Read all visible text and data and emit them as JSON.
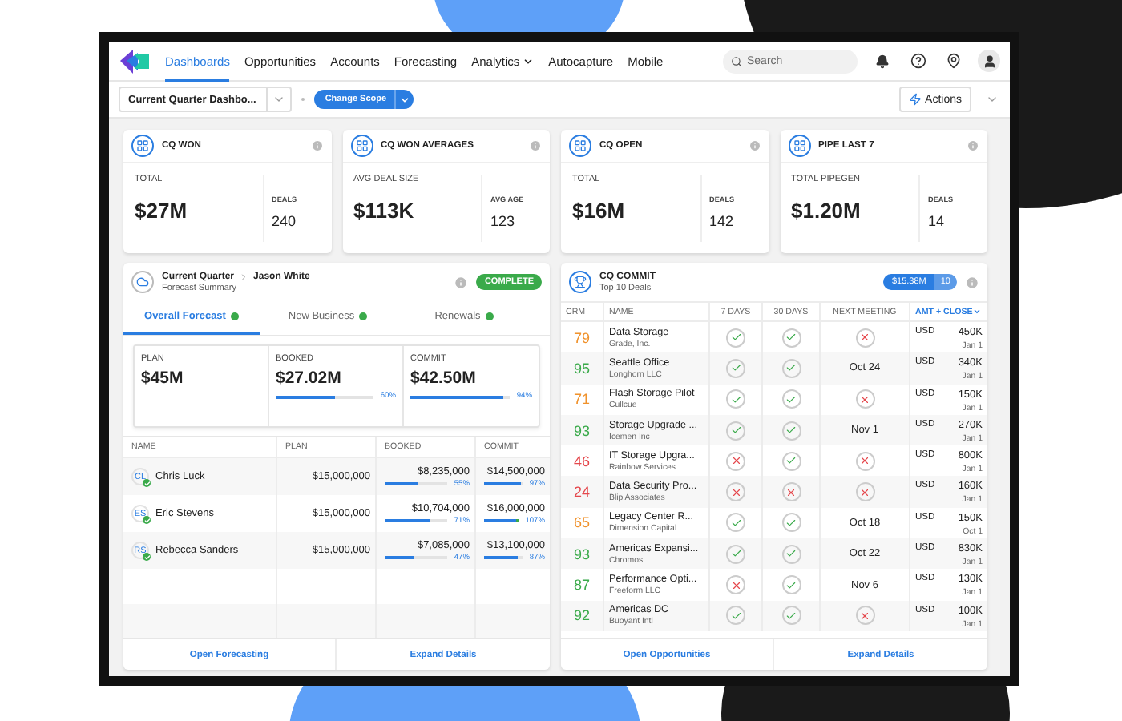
{
  "nav": {
    "items": [
      {
        "label": "Dashboards",
        "selected": true,
        "dropdown": false
      },
      {
        "label": "Opportunities",
        "selected": false,
        "dropdown": false
      },
      {
        "label": "Accounts",
        "selected": false,
        "dropdown": false
      },
      {
        "label": "Forecasting",
        "selected": false,
        "dropdown": false
      },
      {
        "label": "Analytics",
        "selected": false,
        "dropdown": true
      },
      {
        "label": "Autocapture",
        "selected": false,
        "dropdown": false
      },
      {
        "label": "Mobile",
        "selected": false,
        "dropdown": false
      }
    ],
    "search": {
      "placeholder": "Search"
    }
  },
  "toolbar": {
    "dashboard_select": "Current Quarter Dashbo...",
    "scope_button": "Change Scope",
    "actions_button": "Actions"
  },
  "cards": [
    {
      "title": "CQ WON",
      "main_label": "TOTAL",
      "main_value": "$27M",
      "side_label": "DEALS",
      "side_value": "240"
    },
    {
      "title": "CQ WON AVERAGES",
      "main_label": "AVG DEAL SIZE",
      "main_value": "$113K",
      "side_label": "AVG AGE",
      "side_value": "123"
    },
    {
      "title": "CQ OPEN",
      "main_label": "TOTAL",
      "main_value": "$16M",
      "side_label": "DEALS",
      "side_value": "142"
    },
    {
      "title": "PIPE LAST 7",
      "main_label": "TOTAL PIPEGEN",
      "main_value": "$1.20M",
      "side_label": "DEALS",
      "side_value": "14"
    }
  ],
  "forecast": {
    "title": "Current Quarter",
    "owner": "Jason White",
    "subtitle": "Forecast Summary",
    "status": "COMPLETE",
    "tabs": [
      {
        "label": "Overall Forecast",
        "selected": true
      },
      {
        "label": "New Business",
        "selected": false
      },
      {
        "label": "Renewals",
        "selected": false
      }
    ],
    "summary": [
      {
        "label": "PLAN",
        "value": "$45M"
      },
      {
        "label": "BOOKED",
        "value": "$27.02M",
        "level": 0.6,
        "percent": "60%"
      },
      {
        "label": "COMMIT",
        "value": "$42.50M",
        "level": 0.94,
        "percent": "94%"
      }
    ],
    "columns": [
      "NAME",
      "PLAN",
      "BOOKED",
      "COMMIT"
    ],
    "rows": [
      {
        "initials": "CL",
        "name": "Chris Luck",
        "plan": "$15,000,000",
        "booked": {
          "value": "$8,235,000",
          "level": 0.55,
          "percent": "55%"
        },
        "commit": {
          "value": "$14,500,000",
          "level": 0.97,
          "percent": "97%"
        }
      },
      {
        "initials": "ES",
        "name": "Eric Stevens",
        "plan": "$15,000,000",
        "booked": {
          "value": "$10,704,000",
          "level": 0.71,
          "percent": "71%"
        },
        "commit": {
          "value": "$16,000,000",
          "level": 1,
          "percent": "107%"
        }
      },
      {
        "initials": "RS",
        "name": "Rebecca Sanders",
        "plan": "$15,000,000",
        "booked": {
          "value": "$7,085,000",
          "level": 0.47,
          "percent": "47%"
        },
        "commit": {
          "value": "$13,100,000",
          "level": 0.87,
          "percent": "87%"
        }
      }
    ],
    "links": [
      "Open Forecasting",
      "Expand Details"
    ]
  },
  "commit": {
    "title": "CQ COMMIT",
    "subtitle": "Top 10 Deals",
    "total": "$15.38M",
    "count": "10",
    "columns": [
      {
        "label": "CRM",
        "sorted": false
      },
      {
        "label": "NAME",
        "sorted": false
      },
      {
        "label": "7 DAYS",
        "sorted": false
      },
      {
        "label": "30 DAYS",
        "sorted": false
      },
      {
        "label": "NEXT MEETING",
        "sorted": false
      },
      {
        "label": "AMT + CLOSE",
        "sorted": true
      }
    ],
    "rows": [
      {
        "score": "79",
        "color": "#f0922c",
        "name": "Data Storage",
        "account": "Grade, Inc.",
        "days7": true,
        "days30": true,
        "meeting": {
          "kind": "status",
          "ok": false
        },
        "currency": "USD",
        "amount": "450K",
        "close": "Jan 1"
      },
      {
        "score": "95",
        "color": "#3aaa4a",
        "name": "Seattle Office",
        "account": "Longhorn LLC",
        "days7": true,
        "days30": true,
        "meeting": {
          "kind": "date",
          "text": "Oct 24"
        },
        "currency": "USD",
        "amount": "340K",
        "close": "Jan 1"
      },
      {
        "score": "71",
        "color": "#f0922c",
        "name": "Flash Storage Pilot",
        "account": "Cullcue",
        "days7": true,
        "days30": true,
        "meeting": {
          "kind": "status",
          "ok": false
        },
        "currency": "USD",
        "amount": "150K",
        "close": "Jan 1"
      },
      {
        "score": "93",
        "color": "#3aaa4a",
        "name": "Storage Upgrade ...",
        "account": "Icemen Inc",
        "days7": true,
        "days30": true,
        "meeting": {
          "kind": "date",
          "text": "Nov 1"
        },
        "currency": "USD",
        "amount": "270K",
        "close": "Jan 1"
      },
      {
        "score": "46",
        "color": "#e5484d",
        "name": "IT Storage Upgra...",
        "account": "Rainbow Services",
        "days7": false,
        "days30": true,
        "meeting": {
          "kind": "status",
          "ok": false
        },
        "currency": "USD",
        "amount": "800K",
        "close": "Jan 1"
      },
      {
        "score": "24",
        "color": "#e5484d",
        "name": "Data Security Pro...",
        "account": "Blip Associates",
        "days7": false,
        "days30": false,
        "meeting": {
          "kind": "status",
          "ok": false
        },
        "currency": "USD",
        "amount": "160K",
        "close": "Jan 1"
      },
      {
        "score": "65",
        "color": "#f0922c",
        "name": "Legacy Center R...",
        "account": "Dimension Capital",
        "days7": true,
        "days30": true,
        "meeting": {
          "kind": "date",
          "text": "Oct 18"
        },
        "currency": "USD",
        "amount": "150K",
        "close": "Oct 1"
      },
      {
        "score": "93",
        "color": "#3aaa4a",
        "name": "Americas Expansi...",
        "account": "Chromos",
        "days7": true,
        "days30": true,
        "meeting": {
          "kind": "date",
          "text": "Oct 22"
        },
        "currency": "USD",
        "amount": "830K",
        "close": "Jan 1"
      },
      {
        "score": "87",
        "color": "#3aaa4a",
        "name": "Performance Opti...",
        "account": "Freeform LLC",
        "days7": false,
        "days30": true,
        "meeting": {
          "kind": "date",
          "text": "Nov 6"
        },
        "currency": "USD",
        "amount": "130K",
        "close": "Jan 1"
      },
      {
        "score": "92",
        "color": "#3aaa4a",
        "name": "Americas DC",
        "account": "Buoyant Intl",
        "days7": true,
        "days30": true,
        "meeting": {
          "kind": "status",
          "ok": false
        },
        "currency": "USD",
        "amount": "100K",
        "close": "Jan 1"
      }
    ],
    "links": [
      "Open Opportunities",
      "Expand Details"
    ]
  }
}
